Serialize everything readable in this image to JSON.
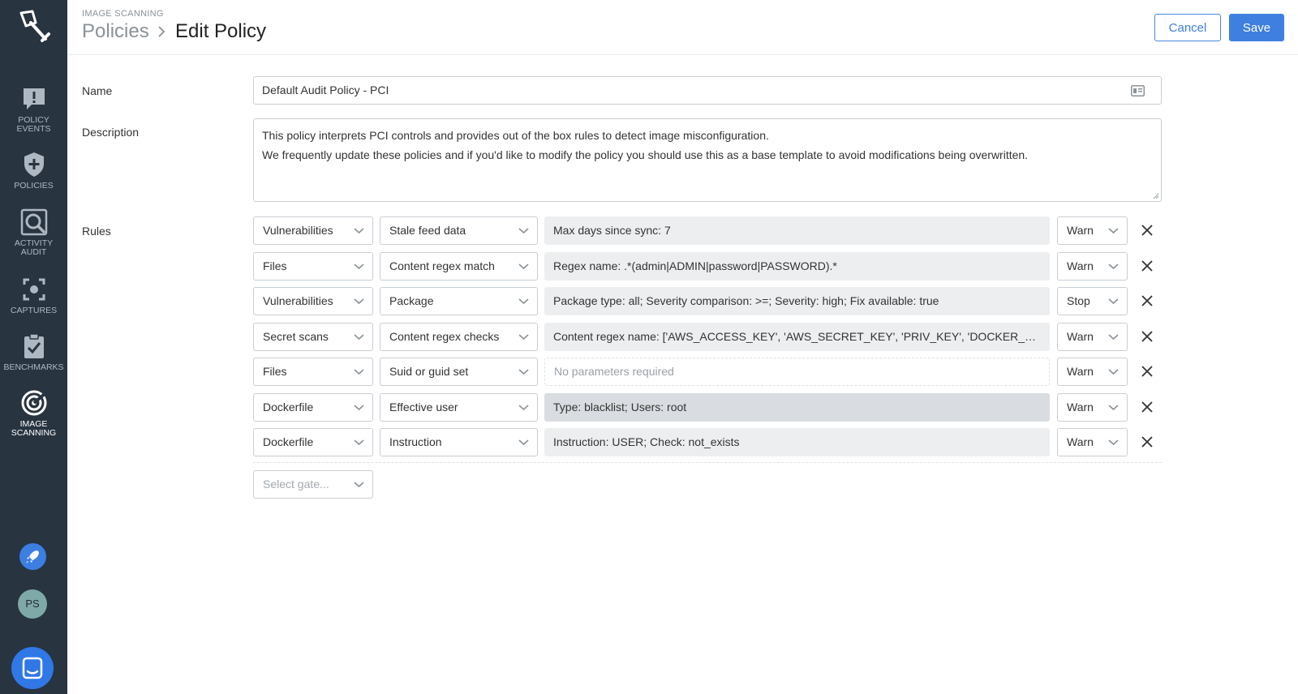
{
  "sidebar": {
    "items": [
      {
        "label": "POLICY EVENTS",
        "icon": "alert-bubble-icon"
      },
      {
        "label": "POLICIES",
        "icon": "shield-plus-icon"
      },
      {
        "label": "ACTIVITY AUDIT",
        "icon": "magnify-icon"
      },
      {
        "label": "CAPTURES",
        "icon": "capture-focus-icon"
      },
      {
        "label": "BENCHMARKS",
        "icon": "clipboard-check-icon"
      },
      {
        "label": "IMAGE SCANNING",
        "icon": "scan-target-icon",
        "active": true
      }
    ],
    "user_initials": "PS"
  },
  "header": {
    "section": "IMAGE SCANNING",
    "breadcrumb_parent": "Policies",
    "breadcrumb_current": "Edit Policy",
    "cancel_label": "Cancel",
    "save_label": "Save"
  },
  "form": {
    "name_label": "Name",
    "name_value": "Default Audit Policy - PCI",
    "description_label": "Description",
    "description_line1": "This policy interprets PCI controls and provides out of the box rules to detect image misconfiguration.",
    "description_line2": "We frequently update these policies and if you'd like to modify the policy you should use this as a base template to avoid modifications being overwritten.",
    "rules_label": "Rules",
    "rules": [
      {
        "gate": "Vulnerabilities",
        "trigger": "Stale feed data",
        "params": "Max days since sync: 7",
        "action": "Warn"
      },
      {
        "gate": "Files",
        "trigger": "Content regex match",
        "params": "Regex name: .*(admin|ADMIN|password|PASSWORD).*",
        "action": "Warn"
      },
      {
        "gate": "Vulnerabilities",
        "trigger": "Package",
        "params": "Package type: all; Severity comparison: >=; Severity: high; Fix available: true",
        "action": "Stop"
      },
      {
        "gate": "Secret scans",
        "trigger": "Content regex checks",
        "params": "Content regex name: ['AWS_ACCESS_KEY', 'AWS_SECRET_KEY', 'PRIV_KEY', 'DOCKER_AUTH', 'API...",
        "action": "Warn"
      },
      {
        "gate": "Files",
        "trigger": "Suid or guid set",
        "params": "No parameters required",
        "action": "Warn"
      },
      {
        "gate": "Dockerfile",
        "trigger": "Effective user",
        "params": "Type: blacklist; Users: root",
        "action": "Warn"
      },
      {
        "gate": "Dockerfile",
        "trigger": "Instruction",
        "params": "Instruction: USER; Check: not_exists",
        "action": "Warn"
      }
    ],
    "gate_placeholder": "Select gate..."
  }
}
